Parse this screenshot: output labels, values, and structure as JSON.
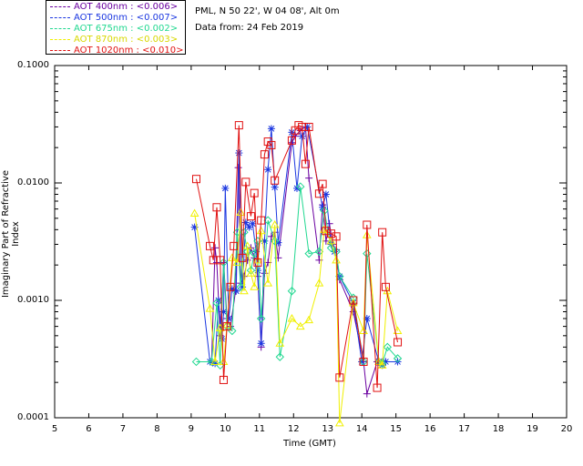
{
  "legend": [
    {
      "label": "AOT  400nm : <0.006>",
      "color": "#6a00a0"
    },
    {
      "label": "AOT  500nm : <0.007>",
      "color": "#1a36e0"
    },
    {
      "label": "AOT  675nm : <0.002>",
      "color": "#20d890"
    },
    {
      "label": "AOT  870nm : <0.003>",
      "color": "#f0f000"
    },
    {
      "label": "AOT 1020nm : <0.010>",
      "color": "#e01010"
    }
  ],
  "info": {
    "site": "PML, N 50 22', W 04 08', Alt 0m",
    "date": "Data from: 24 Feb 2019"
  },
  "chart_data": {
    "type": "line",
    "xlabel": "Time (GMT)",
    "ylabel": "Imaginary Part of Refractive Index",
    "xlim": [
      5,
      20
    ],
    "ylim": [
      0.0001,
      0.1
    ],
    "yscale": "log",
    "xticks": [
      "5",
      "6",
      "7",
      "8",
      "9",
      "10",
      "11",
      "12",
      "13",
      "14",
      "15",
      "16",
      "17",
      "18",
      "19",
      "20"
    ],
    "yticks": [
      "0.1000",
      "0.0100",
      "0.0010",
      "0.0001"
    ],
    "series": [
      {
        "name": "AOT  400nm",
        "color": "#6a00a0",
        "marker": "plus",
        "x": [
          9.6,
          9.7,
          9.75,
          9.85,
          9.95,
          10.05,
          10.15,
          10.3,
          10.38,
          10.45,
          10.55,
          10.65,
          10.75,
          10.85,
          10.95,
          11.05,
          11.15,
          11.25,
          11.35,
          11.45,
          11.55,
          11.95,
          12.05,
          12.2,
          12.35,
          12.45,
          12.75,
          12.85,
          12.95,
          13.05,
          13.15,
          13.25,
          13.35,
          13.75,
          14.05,
          14.15,
          14.45,
          14.6,
          14.7
        ],
        "y": [
          0.0003,
          0.0028,
          0.0021,
          0.0005,
          0.0021,
          0.0007,
          0.0006,
          0.0012,
          0.0135,
          0.0014,
          0.0016,
          0.0022,
          0.0028,
          0.0023,
          0.0016,
          0.0004,
          0.0017,
          0.0021,
          0.0035,
          0.0038,
          0.0023,
          0.022,
          0.025,
          0.028,
          0.03,
          0.011,
          0.0022,
          0.0065,
          0.0032,
          0.0045,
          0.003,
          0.0027,
          0.0015,
          0.0008,
          0.0003,
          0.00016,
          0.0003,
          0.0003,
          0.0003
        ]
      },
      {
        "name": "AOT  500nm",
        "color": "#1a36e0",
        "marker": "asterisk",
        "x": [
          9.1,
          9.55,
          9.7,
          9.8,
          9.9,
          9.95,
          10.0,
          10.1,
          10.2,
          10.32,
          10.4,
          10.5,
          10.6,
          10.7,
          10.8,
          10.9,
          10.95,
          11.05,
          11.15,
          11.25,
          11.35,
          11.45,
          11.55,
          11.95,
          12.1,
          12.25,
          12.4,
          12.85,
          12.95,
          13.1,
          13.2,
          13.35,
          13.75,
          14.0,
          14.15,
          14.5,
          14.6,
          14.7,
          15.05
        ],
        "y": [
          0.0042,
          0.0003,
          0.00029,
          0.001,
          0.00047,
          0.0008,
          0.009,
          0.0007,
          0.00125,
          0.0012,
          0.018,
          0.0013,
          0.0046,
          0.0042,
          0.0045,
          0.0026,
          0.0018,
          0.00043,
          0.0032,
          0.013,
          0.029,
          0.0092,
          0.0031,
          0.027,
          0.009,
          0.025,
          0.03,
          0.0062,
          0.008,
          0.003,
          0.0026,
          0.0016,
          0.00095,
          0.0003,
          0.0007,
          0.0003,
          0.00028,
          0.0003,
          0.0003
        ]
      },
      {
        "name": "AOT  675nm",
        "color": "#20d890",
        "marker": "diamond",
        "x": [
          9.15,
          9.6,
          9.75,
          9.85,
          9.95,
          10.05,
          10.2,
          10.35,
          10.45,
          10.55,
          10.65,
          10.75,
          10.85,
          10.95,
          11.05,
          11.25,
          11.45,
          11.6,
          11.95,
          12.2,
          12.45,
          12.75,
          12.9,
          13.1,
          13.25,
          13.35,
          13.75,
          14.05,
          14.15,
          14.5,
          14.6,
          14.75,
          15.05
        ],
        "y": [
          0.0003,
          0.0003,
          0.00095,
          0.00028,
          0.0021,
          0.0006,
          0.00055,
          0.0038,
          0.0013,
          0.0038,
          0.0026,
          0.0018,
          0.0025,
          0.0032,
          0.0007,
          0.0048,
          0.0032,
          0.00033,
          0.0012,
          0.0093,
          0.0025,
          0.0026,
          0.0058,
          0.0028,
          0.0026,
          0.0016,
          0.00105,
          0.0003,
          0.0025,
          0.0003,
          0.00029,
          0.0004,
          0.00032
        ]
      },
      {
        "name": "AOT  870nm",
        "color": "#f0f000",
        "marker": "triangle",
        "x": [
          9.1,
          9.55,
          9.7,
          9.85,
          9.95,
          10.05,
          10.2,
          10.35,
          10.45,
          10.55,
          10.65,
          10.75,
          10.85,
          10.95,
          11.05,
          11.25,
          11.45,
          11.6,
          11.95,
          12.2,
          12.45,
          12.75,
          12.9,
          13.1,
          13.25,
          13.35,
          13.75,
          14.05,
          14.15,
          14.5,
          14.6,
          14.75,
          15.05
        ],
        "y": [
          0.0055,
          0.00085,
          0.0003,
          0.00058,
          0.0003,
          0.00062,
          0.0023,
          0.0021,
          0.0056,
          0.0012,
          0.0029,
          0.0017,
          0.0013,
          0.0022,
          0.0039,
          0.0014,
          0.0044,
          0.00043,
          0.0007,
          0.0006,
          0.00068,
          0.0014,
          0.004,
          0.0032,
          0.0022,
          9e-05,
          0.00095,
          0.00055,
          0.0036,
          0.0003,
          0.00028,
          0.0012,
          0.00055
        ]
      },
      {
        "name": "AOT 1020nm",
        "color": "#e01010",
        "marker": "square",
        "x": [
          9.15,
          9.55,
          9.65,
          9.75,
          9.85,
          9.95,
          10.05,
          10.15,
          10.25,
          10.4,
          10.5,
          10.6,
          10.75,
          10.85,
          10.95,
          11.05,
          11.15,
          11.25,
          11.35,
          11.45,
          11.95,
          12.05,
          12.15,
          12.25,
          12.35,
          12.45,
          12.75,
          12.85,
          12.95,
          13.1,
          13.25,
          13.35,
          13.75,
          14.05,
          14.15,
          14.45,
          14.6,
          14.7,
          15.05
        ],
        "y": [
          0.0108,
          0.0029,
          0.0022,
          0.0062,
          0.0022,
          0.00021,
          0.0006,
          0.0013,
          0.0029,
          0.031,
          0.0023,
          0.0102,
          0.0052,
          0.0082,
          0.0021,
          0.0048,
          0.0175,
          0.0225,
          0.021,
          0.0105,
          0.023,
          0.028,
          0.031,
          0.03,
          0.0145,
          0.03,
          0.0081,
          0.0098,
          0.0039,
          0.0037,
          0.0035,
          0.00022,
          0.001,
          0.0003,
          0.0044,
          0.00018,
          0.0038,
          0.0013,
          0.00044
        ]
      }
    ]
  }
}
